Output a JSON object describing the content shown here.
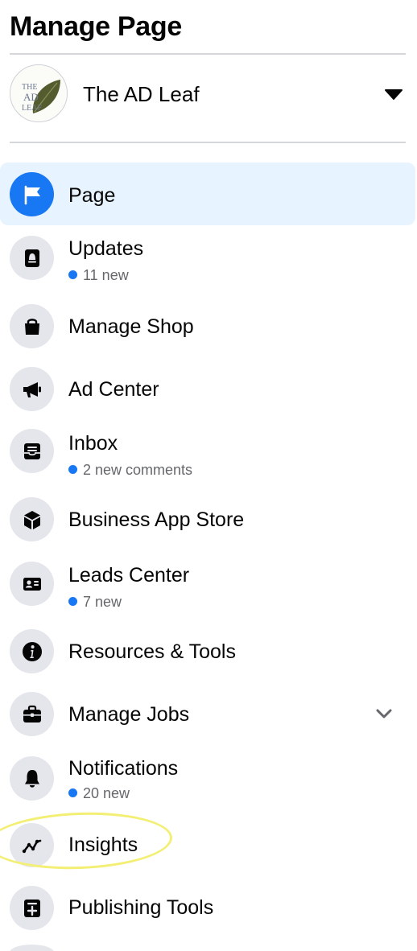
{
  "header": {
    "title": "Manage Page"
  },
  "page": {
    "name": "The AD Leaf",
    "avatar_text": "THE AD LEAF"
  },
  "menu": {
    "items": [
      {
        "label": "Page",
        "icon": "flag-icon"
      },
      {
        "label": "Updates",
        "icon": "updates-icon",
        "badge": "11 new"
      },
      {
        "label": "Manage Shop",
        "icon": "shopping-bag-icon"
      },
      {
        "label": "Ad Center",
        "icon": "megaphone-icon"
      },
      {
        "label": "Inbox",
        "icon": "inbox-icon",
        "badge": "2 new comments"
      },
      {
        "label": "Business App Store",
        "icon": "cube-icon"
      },
      {
        "label": "Leads Center",
        "icon": "id-card-icon",
        "badge": "7 new"
      },
      {
        "label": "Resources & Tools",
        "icon": "info-icon"
      },
      {
        "label": "Manage Jobs",
        "icon": "briefcase-icon"
      },
      {
        "label": "Notifications",
        "icon": "bell-icon",
        "badge": "20 new"
      },
      {
        "label": "Insights",
        "icon": "insights-icon"
      },
      {
        "label": "Publishing Tools",
        "icon": "publishing-tools-icon"
      }
    ]
  },
  "colors": {
    "accent": "#1877f2",
    "active_bg": "#e7f3ff",
    "icon_bg": "#e4e6eb",
    "highlight": "#f3ef74"
  }
}
